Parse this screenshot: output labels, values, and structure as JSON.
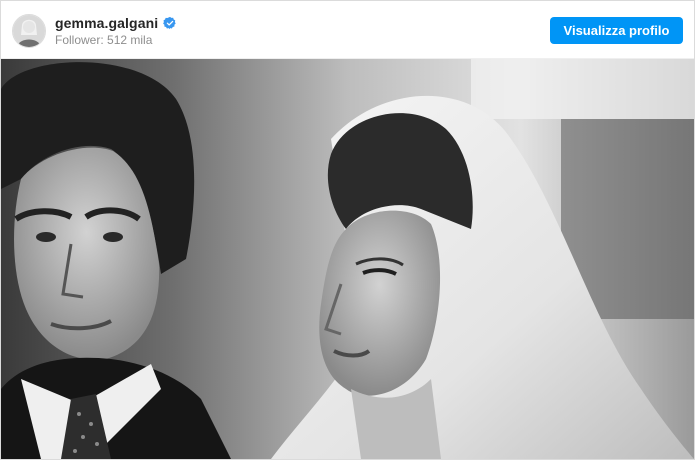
{
  "profile": {
    "username": "gemma.galgani",
    "followers": "Follower: 512 mila",
    "verified_icon": "verified-badge-icon",
    "avatar_icon": "profile-avatar"
  },
  "actions": {
    "view_profile_label": "Visualizza profilo"
  },
  "post": {
    "photo": "black-and-white-wedding-photo"
  },
  "colors": {
    "accent": "#0095f6",
    "text_primary": "#262626",
    "text_secondary": "#8e8e8e"
  }
}
